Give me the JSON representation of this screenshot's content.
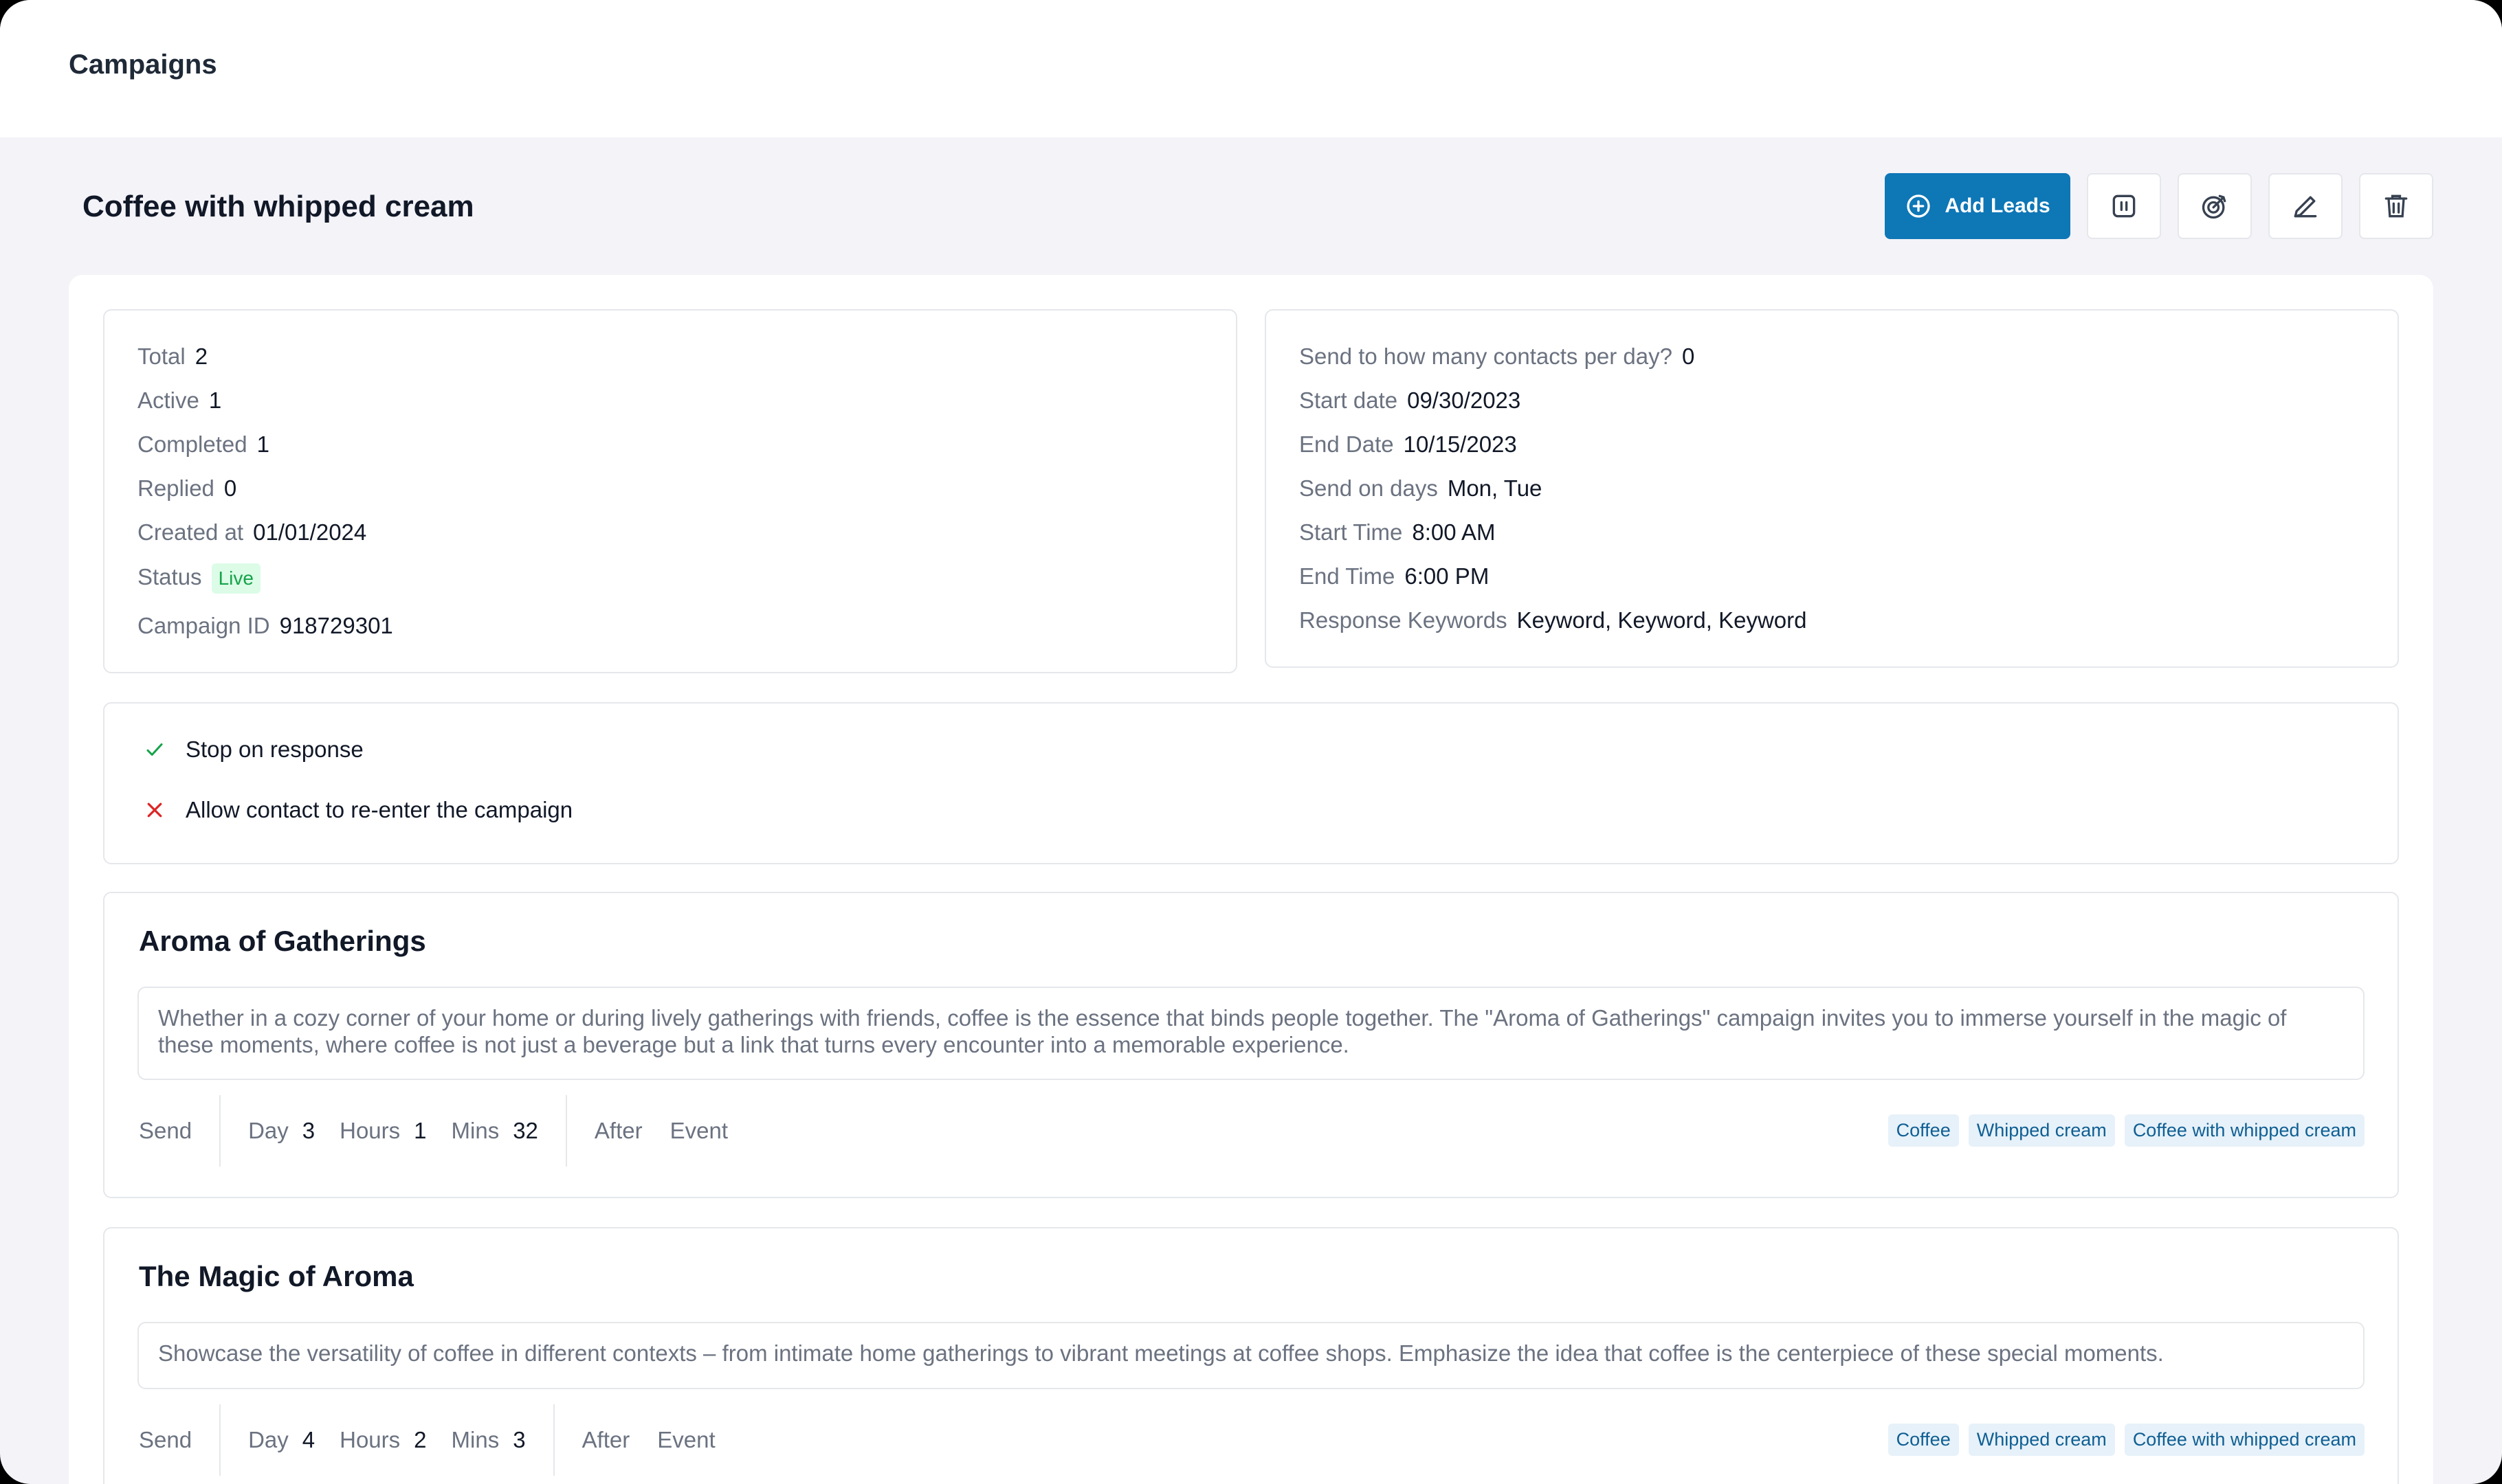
{
  "app": {
    "title": "Campaigns"
  },
  "campaign": {
    "title": "Coffee with whipped cream",
    "actions": {
      "add_leads_label": "Add Leads",
      "icons": [
        "plus-circle-icon",
        "pause-icon",
        "target-icon",
        "edit-icon",
        "trash-icon"
      ]
    }
  },
  "stats": {
    "total_label": "Total",
    "total": "2",
    "active_label": "Active",
    "active": "1",
    "completed_label": "Completed",
    "completed": "1",
    "replied_label": "Replied",
    "replied": "0",
    "created_label": "Created at",
    "created": "01/01/2024",
    "status_label": "Status",
    "status": "Live",
    "id_label": "Campaign ID",
    "id": "918729301"
  },
  "settings": {
    "per_day_label": "Send to how many contacts per day?",
    "per_day": "0",
    "start_date_label": "Start date",
    "start_date": "09/30/2023",
    "end_date_label": "End Date",
    "end_date": "10/15/2023",
    "days_label": "Send on days",
    "days": "Mon, Tue",
    "start_time_label": "Start Time",
    "start_time": "8:00 AM",
    "end_time_label": "End Time",
    "end_time": "6:00 PM",
    "keywords_label": "Response Keywords",
    "keywords": "Keyword, Keyword, Keyword"
  },
  "options": {
    "stop_on_response": {
      "label": "Stop on response",
      "enabled": true
    },
    "reenter": {
      "label": "Allow contact to re-enter the campaign",
      "enabled": false
    }
  },
  "steps": [
    {
      "title": "Aroma of Gatherings",
      "description": "Whether in a cozy corner of your home or during lively gatherings with friends, coffee is the essence that binds people together. The \"Aroma of Gatherings\" campaign invites you to immerse yourself in the magic of these moments, where coffee is not just a beverage but a link that turns every encounter into a memorable experience.",
      "send_label": "Send",
      "day_label": "Day",
      "day": "3",
      "hours_label": "Hours",
      "hours": "1",
      "mins_label": "Mins",
      "mins": "32",
      "after_label": "After",
      "event_label": "Event",
      "tags": [
        "Coffee",
        "Whipped cream",
        "Coffee with whipped cream"
      ]
    },
    {
      "title": "The Magic of Aroma",
      "description": "Showcase the versatility of coffee in different contexts – from intimate home gatherings to vibrant meetings at coffee shops. Emphasize the idea that coffee is the centerpiece of these special moments.",
      "send_label": "Send",
      "day_label": "Day",
      "day": "4",
      "hours_label": "Hours",
      "hours": "2",
      "mins_label": "Mins",
      "mins": "3",
      "after_label": "After",
      "event_label": "Event",
      "tags": [
        "Coffee",
        "Whipped cream",
        "Coffee with whipped cream"
      ]
    }
  ],
  "colors": {
    "primary": "#0e77b6",
    "live_bg": "#dcfce7",
    "live_fg": "#16a34a",
    "check": "#16a34a",
    "cross": "#dc2626",
    "tag_bg": "#e7f1f9",
    "tag_fg": "#0f5f93"
  }
}
